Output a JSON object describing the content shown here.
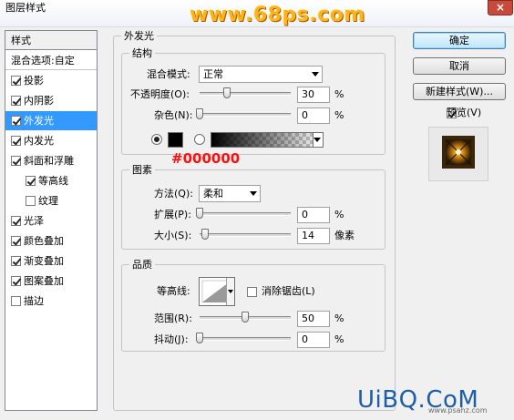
{
  "window": {
    "title": "图层样式",
    "close_glyph": "×",
    "watermark_top": "www.68ps.com",
    "watermark_bottom": "UiBQ.CoM",
    "watermark_bottom_sub": "www.psahz.com"
  },
  "style_list": {
    "header": "样式",
    "blend_options": "混合选项:自定",
    "items": [
      {
        "label": "投影",
        "checked": true
      },
      {
        "label": "内阴影",
        "checked": true
      },
      {
        "label": "外发光",
        "checked": true,
        "selected": true
      },
      {
        "label": "内发光",
        "checked": true
      },
      {
        "label": "斜面和浮雕",
        "checked": true
      },
      {
        "label": "等高线",
        "checked": true,
        "sub": true
      },
      {
        "label": "纹理",
        "checked": false,
        "sub": true
      },
      {
        "label": "光泽",
        "checked": true
      },
      {
        "label": "颜色叠加",
        "checked": true
      },
      {
        "label": "渐变叠加",
        "checked": true
      },
      {
        "label": "图案叠加",
        "checked": true
      },
      {
        "label": "描边",
        "checked": false
      }
    ]
  },
  "outer_glow": {
    "title": "外发光",
    "structure": {
      "title": "结构",
      "blend_mode_label": "混合模式:",
      "blend_mode_value": "正常",
      "opacity_label": "不透明度(O):",
      "opacity_value": "30",
      "opacity_unit": "%",
      "noise_label": "杂色(N):",
      "noise_value": "0",
      "noise_unit": "%"
    },
    "annotation_color": "#000000",
    "elements": {
      "title": "图素",
      "technique_label": "方法(Q):",
      "technique_value": "柔和",
      "spread_label": "扩展(P):",
      "spread_value": "0",
      "spread_unit": "%",
      "size_label": "大小(S):",
      "size_value": "14",
      "size_unit": "像素"
    },
    "quality": {
      "title": "品质",
      "contour_label": "等高线:",
      "anti_alias_label": "消除锯齿(L)",
      "range_label": "范围(R):",
      "range_value": "50",
      "range_unit": "%",
      "jitter_label": "抖动(J):",
      "jitter_value": "0",
      "jitter_unit": "%"
    }
  },
  "buttons": {
    "ok": "确定",
    "cancel": "取消",
    "new_style": "新建样式(W)...",
    "preview": "预览(V)"
  },
  "colors": {
    "selection": "#3399ff",
    "glow_swatch": "#000000",
    "annotation": "#ff1010"
  }
}
